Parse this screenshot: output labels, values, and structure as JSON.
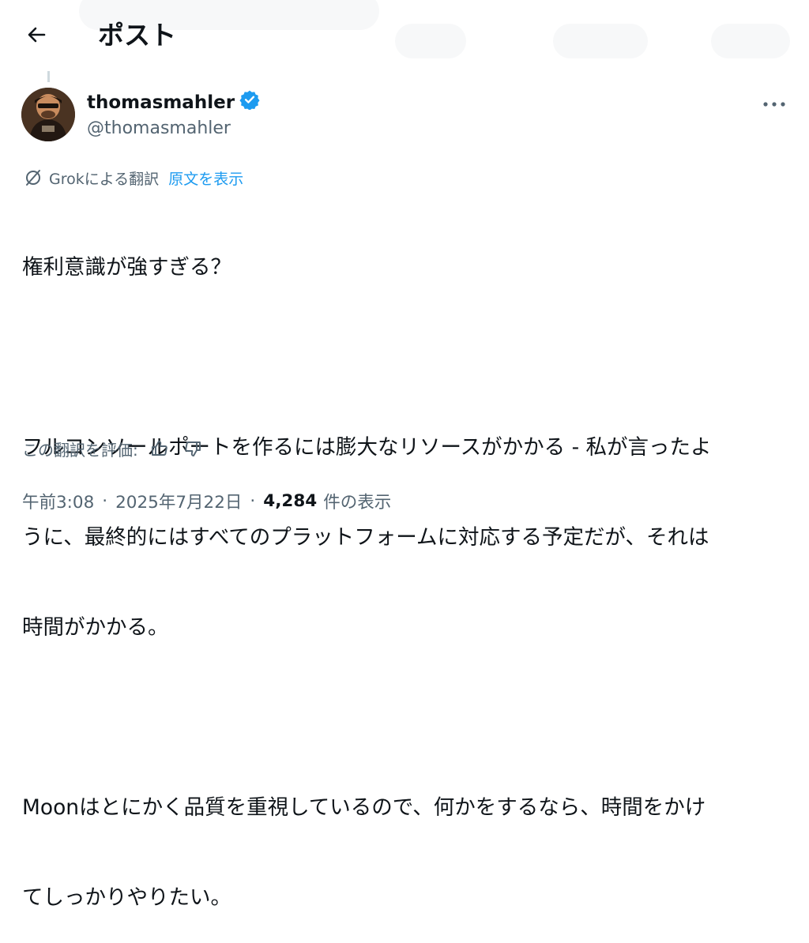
{
  "header": {
    "title": "ポスト",
    "back_icon": "arrow-left-icon"
  },
  "author": {
    "display_name": "thomasmahler",
    "handle": "@thomasmahler",
    "verified": true,
    "verified_color": "#1d9bf0"
  },
  "translation": {
    "translated_by": "Grokによる翻訳",
    "show_original": "原文を表示",
    "icon": "translate-icon"
  },
  "tweet": {
    "lines": [
      "権利意識が強すぎる？",
      "",
      "フルコンソールポートを作るには膨大なリソースがかかる - 私が言ったよ",
      "うに、最終的にはすべてのプラットフォームに対応する予定だが、それは",
      "時間がかかる。",
      "",
      "Moonはとにかく品質を重視しているので、何かをするなら、時間をかけ",
      "てしっかりやりたい。"
    ]
  },
  "rating": {
    "label": "この翻訳を評価:",
    "up_icon": "thumbs-up-icon",
    "down_icon": "thumbs-down-icon"
  },
  "meta": {
    "time": "午前3:08",
    "date": "2025年7月22日",
    "separator": "·",
    "views_count": "4,284",
    "views_label": "件の表示"
  },
  "colors": {
    "text": "#0f1419",
    "secondary": "#536471",
    "accent": "#1d9bf0"
  }
}
